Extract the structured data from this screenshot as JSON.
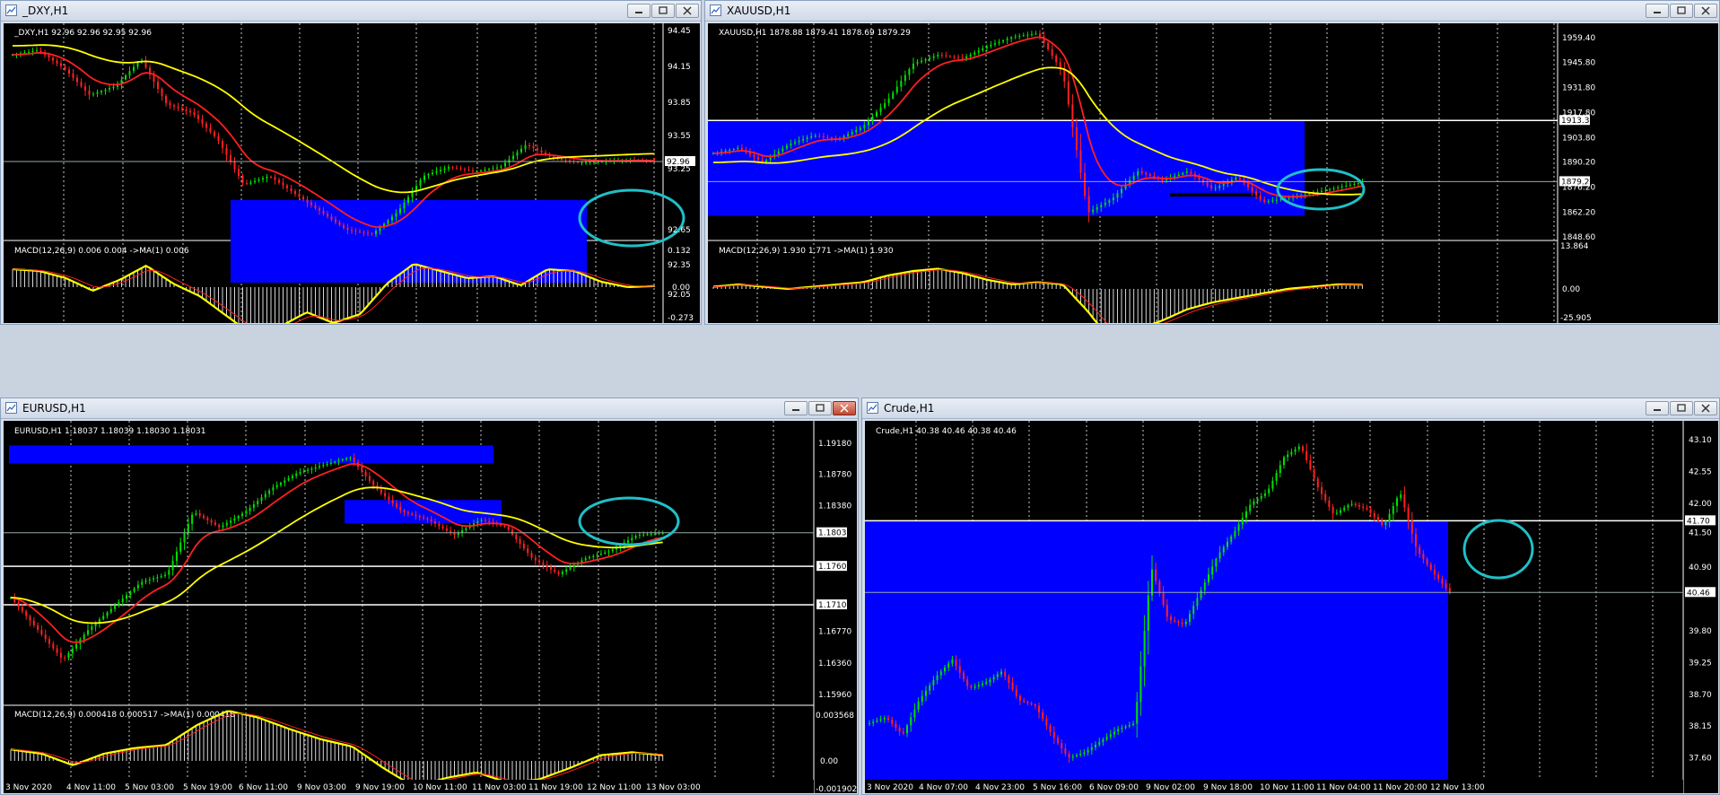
{
  "windows": {
    "dxy": {
      "title": "_DXY,H1",
      "ohlc_label": "_DXY,H1  92.96 92.96 92.95 92.96",
      "price_ticks": [
        "94.45",
        "94.15",
        "93.85",
        "93.55",
        "93.25",
        "92.96",
        "92.65",
        "92.35",
        "92.05"
      ],
      "macd_label": "MACD(12,26,9) 0.006 0.004  ->MA(1) 0.006",
      "macd_ticks": [
        "0.132",
        "0.00",
        "-0.273"
      ]
    },
    "xauusd": {
      "title": "XAUUSD,H1",
      "ohlc_label": "XAUUSD,H1  1878.88 1879.41 1878.69 1879.29",
      "price_ticks": [
        "1959.40",
        "1945.80",
        "1931.80",
        "1917.80",
        "1913.38",
        "1903.80",
        "1890.20",
        "1879.29",
        "1876.20",
        "1862.20",
        "1848.60"
      ],
      "macd_label": "MACD(12,26,9) 1.930 1.771  ->MA(1) 1.930",
      "macd_ticks": [
        "13.864",
        "0.00",
        "-25.905"
      ]
    },
    "eurusd": {
      "title": "EURUSD,H1",
      "ohlc_label": "EURUSD,H1  1.18037 1.18039 1.18030 1.18031",
      "price_ticks": [
        "1.19180",
        "1.18780",
        "1.18380",
        "1.18031",
        "1.17600",
        "1.17107",
        "1.16770",
        "1.16360",
        "1.15960"
      ],
      "macd_label": "MACD(12,26,9) 0.000418 0.000517  ->MA(1) 0.000418",
      "macd_ticks": [
        "0.003568",
        "0.00",
        "-0.001902"
      ],
      "time_ticks": [
        "3 Nov 2020",
        "4 Nov 11:00",
        "5 Nov 03:00",
        "5 Nov 19:00",
        "6 Nov 11:00",
        "9 Nov 03:00",
        "9 Nov 19:00",
        "10 Nov 11:00",
        "11 Nov 03:00",
        "11 Nov 19:00",
        "12 Nov 11:00",
        "13 Nov 03:00"
      ]
    },
    "crude": {
      "title": "Crude,H1",
      "ohlc_label": "Crude,H1  40.38 40.46 40.38 40.46",
      "price_ticks": [
        "43.10",
        "42.55",
        "42.00",
        "41.70",
        "41.50",
        "40.90",
        "40.46",
        "39.80",
        "39.25",
        "38.70",
        "38.15",
        "37.60"
      ],
      "time_ticks": [
        "3 Nov 2020",
        "4 Nov 07:00",
        "4 Nov 23:00",
        "5 Nov 16:00",
        "6 Nov 09:00",
        "9 Nov 02:00",
        "9 Nov 18:00",
        "10 Nov 11:00",
        "11 Nov 04:00",
        "11 Nov 20:00",
        "12 Nov 13:00"
      ]
    }
  },
  "colors": {
    "zone": "#0000ff",
    "bull": "#00e000",
    "bear": "#ff2020",
    "ma_fast": "#ff2020",
    "ma_slow": "#ffff00",
    "highlight": "#20c0c8",
    "hline": "#ffffff"
  },
  "icons": [
    "chart-window-icon",
    "minimize-icon",
    "maximize-icon",
    "close-icon"
  ]
}
